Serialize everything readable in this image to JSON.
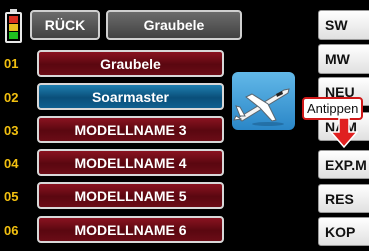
{
  "header": {
    "back_label": "RÜCK",
    "title": "Graubele"
  },
  "battery": {
    "colors": [
      "#d83020",
      "#e8c020",
      "#20c020"
    ]
  },
  "model_list": [
    {
      "number": "01",
      "name": "Graubele",
      "selected": false
    },
    {
      "number": "02",
      "name": "Soarmaster",
      "selected": true
    },
    {
      "number": "03",
      "name": "MODELLNAME 3",
      "selected": false
    },
    {
      "number": "04",
      "name": "MODELLNAME 4",
      "selected": false
    },
    {
      "number": "05",
      "name": "MODELLNAME 5",
      "selected": false
    },
    {
      "number": "06",
      "name": "MODELLNAME 6",
      "selected": false
    }
  ],
  "side_buttons": {
    "sw": "SW",
    "mw": "MW",
    "neu": "NEU",
    "nam": "NAM",
    "expm": "EXP.M",
    "res": "RES",
    "kop": "KOP"
  },
  "tooltip": "Antippen",
  "icons": {
    "model_type": "glider-plane-icon",
    "hint": "arrow-down-icon"
  },
  "colors": {
    "number_yellow": "#f2c010",
    "row_red": "#6b0c16",
    "row_blue": "#0a4f7a",
    "hint_red": "#d01818"
  }
}
